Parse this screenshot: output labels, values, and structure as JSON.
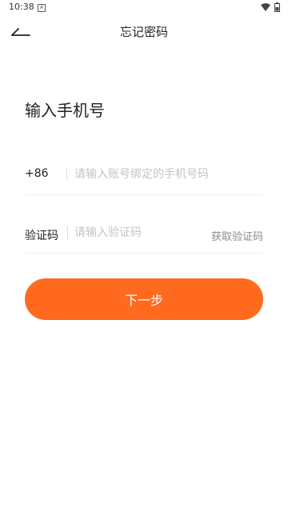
{
  "status_bar": {
    "time": "10:38",
    "notification_icon": "A",
    "icons": [
      "wifi-icon",
      "battery-icon"
    ]
  },
  "header": {
    "title": "忘记密码",
    "back_icon": "back-arrow-icon"
  },
  "form": {
    "heading": "输入手机号",
    "phone": {
      "country_code": "+86",
      "value": "",
      "placeholder": "请输入账号绑定的手机号码"
    },
    "code": {
      "label": "验证码",
      "value": "",
      "placeholder": "请输入验证码",
      "get_code_label": "获取验证码"
    },
    "submit_label": "下一步"
  },
  "colors": {
    "accent": "#ff6a1f",
    "placeholder": "#c4c4c4",
    "divider": "#ececec",
    "secondary_text": "#8a8a8a"
  }
}
